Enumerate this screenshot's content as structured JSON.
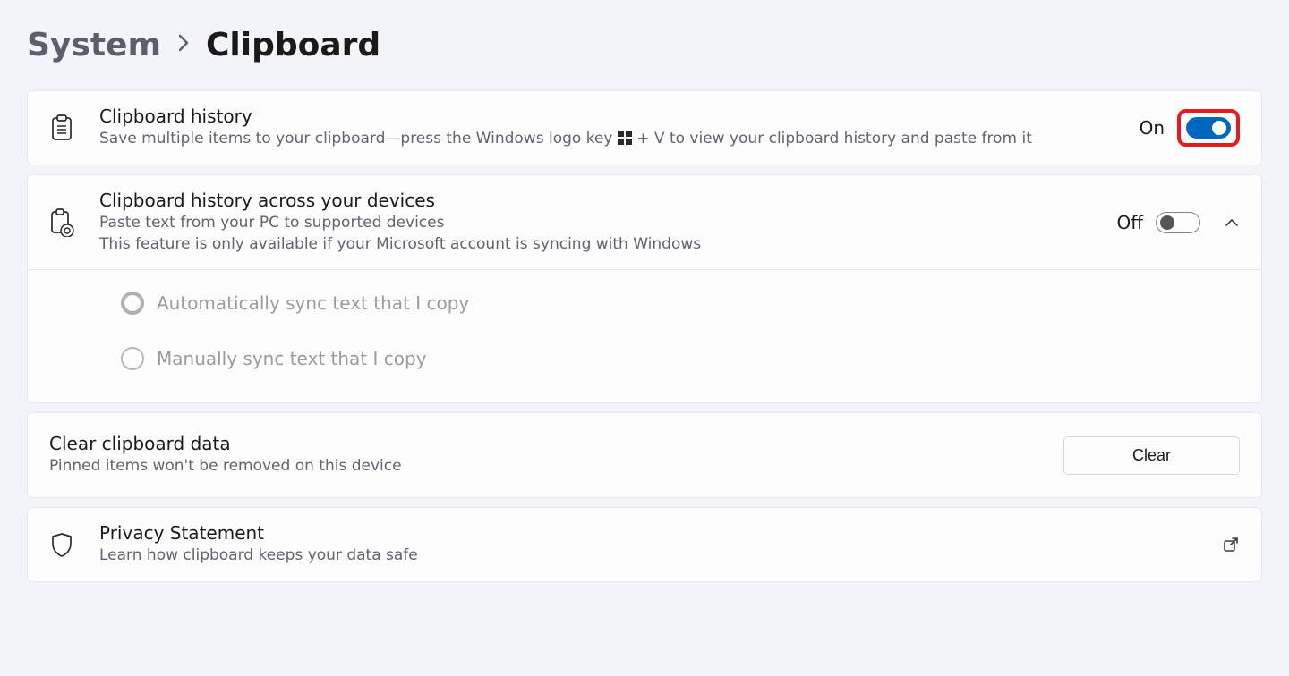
{
  "breadcrumb": {
    "parent": "System",
    "current": "Clipboard"
  },
  "clipboardHistory": {
    "title": "Clipboard history",
    "descPre": "Save multiple items to your clipboard—press the Windows logo key ",
    "descPost": " + V to view your clipboard history and paste from it",
    "state": "On"
  },
  "syncDevices": {
    "title": "Clipboard history across your devices",
    "desc1": "Paste text from your PC to supported devices",
    "desc2": "This feature is only available if your Microsoft account is syncing with Windows",
    "state": "Off",
    "options": {
      "auto": "Automatically sync text that I copy",
      "manual": "Manually sync text that I copy"
    }
  },
  "clear": {
    "title": "Clear clipboard data",
    "desc": "Pinned items won't be removed on this device",
    "button": "Clear"
  },
  "privacy": {
    "title": "Privacy Statement",
    "desc": "Learn how clipboard keeps your data safe"
  }
}
